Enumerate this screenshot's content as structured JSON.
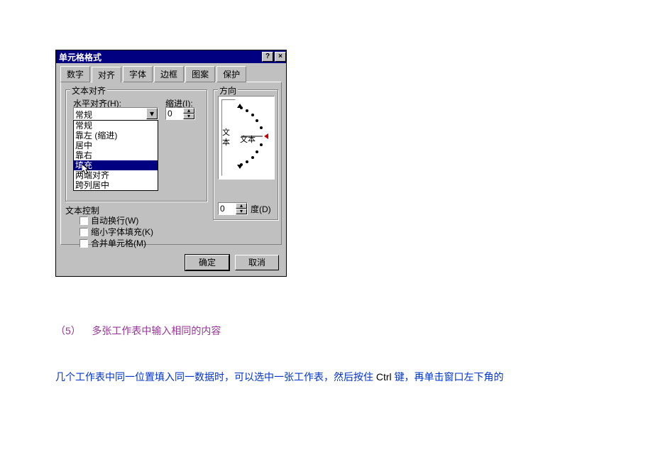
{
  "dialog": {
    "title": "单元格格式",
    "help_btn": "?",
    "close_btn": "×",
    "tabs": [
      "数字",
      "对齐",
      "字体",
      "边框",
      "图案",
      "保护"
    ],
    "active_tab_index": 1,
    "group_text_align": "文本对齐",
    "label_h_align": "水平对齐(H):",
    "label_indent": "缩进(I):",
    "combo_value": "常规",
    "indent_value": "0",
    "dropdown_options": [
      "常规",
      "靠左 (缩进)",
      "居中",
      "靠右",
      "填充",
      "两端对齐",
      "跨列居中"
    ],
    "dropdown_highlight_index": 4,
    "label_text_control": "文本控制",
    "chk_wrap": "自动换行(W)",
    "chk_shrink": "缩小字体填充(K)",
    "chk_merge": "合并单元格(M)",
    "group_direction": "方向",
    "orient_vertical_text": "文本",
    "orient_label_text": "文本",
    "degree_value": "0",
    "degree_label": "度(D)",
    "btn_ok": "确定",
    "btn_cancel": "取消"
  },
  "article": {
    "line1_a": "（5）",
    "line1_b": "多张工作表中输入相同的内容",
    "line2_a": "几个工作表中同一位置填入同一数据时，可以选中一张工作表，然后按住",
    "line2_ctrl": " Ctrl ",
    "line2_b": "键，再单击窗口左下角的"
  }
}
